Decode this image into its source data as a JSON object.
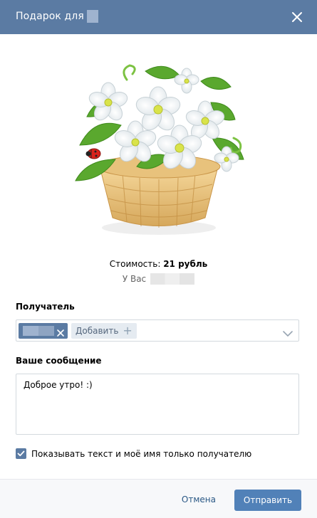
{
  "header": {
    "title": "Подарок для",
    "background_color": "#5b7ba3",
    "close_icon": "close-icon"
  },
  "gift": {
    "image_icon": "flower-basket-image"
  },
  "price": {
    "label": "Стоимость:",
    "value": "21 рубль"
  },
  "balance": {
    "label": "У Вас"
  },
  "recipient": {
    "label": "Получатель",
    "add_label": "Добавить",
    "add_icon": "plus-icon",
    "remove_icon": "close-icon",
    "dropdown_icon": "chevron-down-icon"
  },
  "message": {
    "label": "Ваше сообщение",
    "value": "Доброе утро! :)"
  },
  "privacy": {
    "label": "Показывать текст и моё имя только получателю",
    "checked": true
  },
  "footer": {
    "cancel_label": "Отмена",
    "send_label": "Отправить",
    "accent_color": "#5181b8"
  }
}
